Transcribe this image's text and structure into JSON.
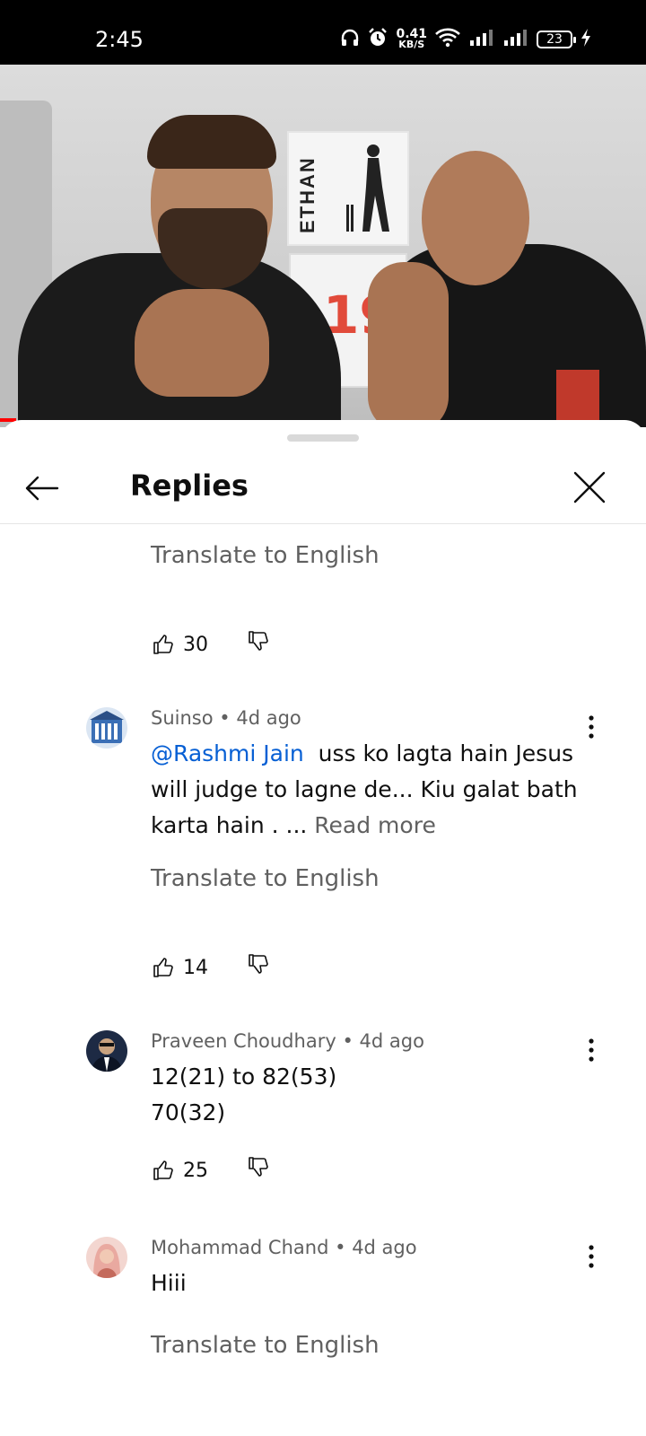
{
  "status_bar": {
    "time": "2:45",
    "net_speed_value": "0.41",
    "net_speed_unit": "KB/S",
    "battery_level": "23"
  },
  "video": {
    "poster_text": "ETHAN",
    "progress_fraction": 0.025
  },
  "header": {
    "title": "Replies"
  },
  "top_fragment": {
    "translate_label": "Translate to English",
    "like_count": "30"
  },
  "comments": [
    {
      "author": "Suinso",
      "time": "4d ago",
      "separator": "•",
      "mention": "@Rashmi Jain",
      "text": "uss ko lagta hain Jesus will judge to lagne de... Kiu galat bath karta hain . ...",
      "read_more": "Read more",
      "translate_label": "Translate to English",
      "like_count": "14",
      "avatar_colors": [
        "#3b6fb6",
        "#ffffff"
      ]
    },
    {
      "author": "Praveen Choudhary",
      "time": "4d ago",
      "separator": "•",
      "line1": "12(21) to 82(53)",
      "line2": "70(32)",
      "like_count": "25",
      "avatar_colors": [
        "#1d2a44",
        "#c9a27f"
      ]
    },
    {
      "author": "Mohammad Chand",
      "time": "4d ago",
      "separator": "•",
      "text": "Hiii",
      "translate_label": "Translate to English",
      "avatar_colors": [
        "#e9a9a0",
        "#c46a5c"
      ]
    }
  ]
}
